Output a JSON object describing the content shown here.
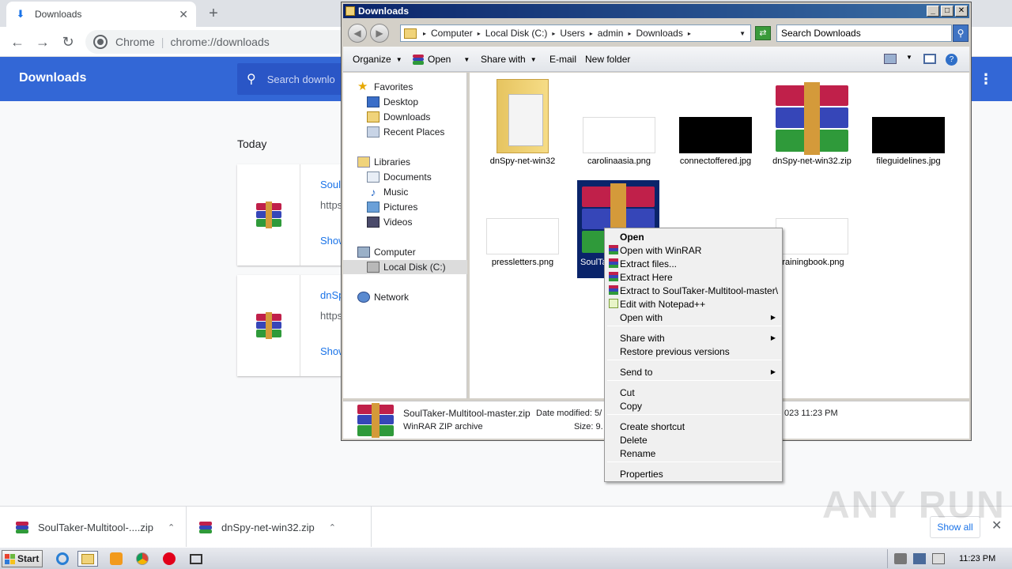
{
  "chrome": {
    "tab_title": "Downloads",
    "new_tab": "+",
    "close": "✕",
    "back": "←",
    "forward": "→",
    "reload": "↻",
    "omni_chip": "Chrome",
    "omni_sep": "|",
    "omni_url": "chrome://downloads"
  },
  "downloads_page": {
    "header_title": "Downloads",
    "search_placeholder": "Search downlo",
    "menu_icon": "⋮",
    "section_title": "Today",
    "items": [
      {
        "name": "Soul",
        "url": "https",
        "show": "Show"
      },
      {
        "name": "dnSp",
        "url": "https",
        "show": "Show"
      }
    ]
  },
  "shelf": {
    "items": [
      {
        "name": "SoulTaker-Multitool-....zip",
        "caret": "⌃"
      },
      {
        "name": "dnSpy-net-win32.zip",
        "caret": "⌃"
      }
    ],
    "show_all": "Show all",
    "close": "✕"
  },
  "watermark": "ANY RUN",
  "explorer": {
    "title": "Downloads",
    "caption": {
      "min": "_",
      "max": "□",
      "close": "✕"
    },
    "breadcrumb": [
      "Computer",
      "Local Disk (C:)",
      "Users",
      "admin",
      "Downloads"
    ],
    "crumb_sep": "▸",
    "search_placeholder": "Search Downloads",
    "commands": {
      "organize": "Organize",
      "open": "Open",
      "share_with": "Share with",
      "email": "E-mail",
      "new_folder": "New folder"
    },
    "nav": {
      "favorites": "Favorites",
      "desktop": "Desktop",
      "downloads": "Downloads",
      "recent_places": "Recent Places",
      "libraries": "Libraries",
      "documents": "Documents",
      "music": "Music",
      "pictures": "Pictures",
      "videos": "Videos",
      "computer": "Computer",
      "local_disk": "Local Disk (C:)",
      "network": "Network"
    },
    "files": [
      {
        "label": "dnSpy-net-win32",
        "kind": "folder"
      },
      {
        "label": "carolinaasia.png",
        "kind": "white-image"
      },
      {
        "label": "connectoffered.jpg",
        "kind": "black-image"
      },
      {
        "label": "dnSpy-net-win32.zip",
        "kind": "rar"
      },
      {
        "label": "fileguidelines.jpg",
        "kind": "black-image"
      },
      {
        "label": "pressletters.png",
        "kind": "white-image"
      },
      {
        "label": "SoulTa",
        "label2": "m",
        "kind": "rar"
      },
      {
        "label": "trainingbook.png",
        "kind": "white-image"
      }
    ],
    "status": {
      "filename": "SoulTaker-Multitool-master.zip",
      "modified_label": "Date modified: 5/",
      "modified_tail": "023 11:23 PM",
      "type": "WinRAR ZIP archive",
      "size_label": "Size: 9."
    }
  },
  "context_menu": {
    "items": [
      {
        "label": "Open",
        "bold": true
      },
      {
        "label": "Open with WinRAR",
        "icon": "winrar-icon"
      },
      {
        "label": "Extract files...",
        "icon": "winrar-icon"
      },
      {
        "label": "Extract Here",
        "icon": "winrar-icon"
      },
      {
        "label": "Extract to SoulTaker-Multitool-master\\",
        "icon": "winrar-icon"
      },
      {
        "label": "Edit with Notepad++",
        "icon": "notepadpp-icon"
      },
      {
        "label": "Open with",
        "submenu": true
      },
      {
        "label": "Share with",
        "submenu": true
      },
      {
        "label": "Restore previous versions"
      },
      {
        "label": "Send to",
        "submenu": true
      },
      {
        "label": "Cut"
      },
      {
        "label": "Copy"
      },
      {
        "label": "Create shortcut"
      },
      {
        "label": "Delete"
      },
      {
        "label": "Rename"
      },
      {
        "label": "Properties"
      }
    ],
    "submenu_arrow": "▶"
  },
  "taskbar": {
    "start": "Start",
    "clock": "11:23 PM"
  },
  "colors": {
    "chrome_header": "#3367d6",
    "link_blue": "#1a73e8",
    "title_bar": "#0a246a",
    "selection": "#0a246a"
  }
}
